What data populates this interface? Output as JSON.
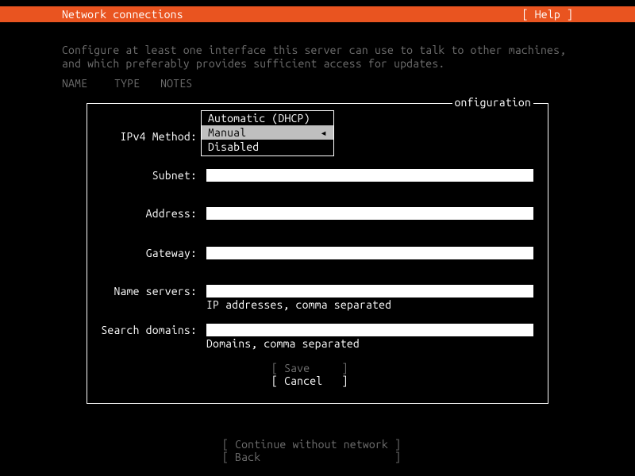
{
  "header": {
    "title": "Network connections",
    "help": "[ Help ]"
  },
  "description": "Configure at least one interface this server can use to talk to other machines,\nand which preferably provides sufficient access for updates.",
  "columns": {
    "name": "NAME",
    "type": "TYPE",
    "notes": "NOTES"
  },
  "box": {
    "title": "onfiguration"
  },
  "form": {
    "method_label": "IPv4 Method:",
    "subnet_label": "Subnet:",
    "address_label": "Address:",
    "gateway_label": "Gateway:",
    "nameservers_label": "Name servers:",
    "nameservers_hint": "IP addresses, comma separated",
    "searchdomains_label": "Search domains:",
    "searchdomains_hint": "Domains, comma separated"
  },
  "dropdown": {
    "options": [
      "Automatic (DHCP)",
      "Manual",
      "Disabled"
    ],
    "automatic": "Automatic (DHCP)",
    "manual": "Manual",
    "disabled": "Disabled",
    "arrow": "◂"
  },
  "buttons": {
    "save": "[ Save     ]",
    "cancel": "[ Cancel   ]",
    "continue": "[ Continue without network ]",
    "back": "[ Back                     ]"
  }
}
